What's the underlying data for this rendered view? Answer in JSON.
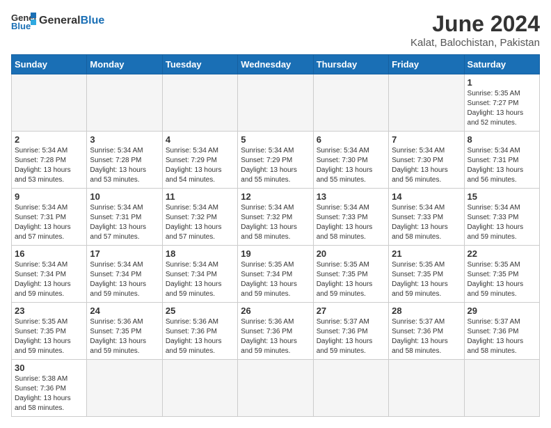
{
  "header": {
    "logo_general": "General",
    "logo_blue": "Blue",
    "month_year": "June 2024",
    "location": "Kalat, Balochistan, Pakistan"
  },
  "columns": [
    "Sunday",
    "Monday",
    "Tuesday",
    "Wednesday",
    "Thursday",
    "Friday",
    "Saturday"
  ],
  "weeks": [
    [
      {
        "day": "",
        "info": ""
      },
      {
        "day": "",
        "info": ""
      },
      {
        "day": "",
        "info": ""
      },
      {
        "day": "",
        "info": ""
      },
      {
        "day": "",
        "info": ""
      },
      {
        "day": "",
        "info": ""
      },
      {
        "day": "1",
        "info": "Sunrise: 5:35 AM\nSunset: 7:27 PM\nDaylight: 13 hours\nand 52 minutes."
      }
    ],
    [
      {
        "day": "2",
        "info": "Sunrise: 5:34 AM\nSunset: 7:28 PM\nDaylight: 13 hours\nand 53 minutes."
      },
      {
        "day": "3",
        "info": "Sunrise: 5:34 AM\nSunset: 7:28 PM\nDaylight: 13 hours\nand 53 minutes."
      },
      {
        "day": "4",
        "info": "Sunrise: 5:34 AM\nSunset: 7:29 PM\nDaylight: 13 hours\nand 54 minutes."
      },
      {
        "day": "5",
        "info": "Sunrise: 5:34 AM\nSunset: 7:29 PM\nDaylight: 13 hours\nand 55 minutes."
      },
      {
        "day": "6",
        "info": "Sunrise: 5:34 AM\nSunset: 7:30 PM\nDaylight: 13 hours\nand 55 minutes."
      },
      {
        "day": "7",
        "info": "Sunrise: 5:34 AM\nSunset: 7:30 PM\nDaylight: 13 hours\nand 56 minutes."
      },
      {
        "day": "8",
        "info": "Sunrise: 5:34 AM\nSunset: 7:31 PM\nDaylight: 13 hours\nand 56 minutes."
      }
    ],
    [
      {
        "day": "9",
        "info": "Sunrise: 5:34 AM\nSunset: 7:31 PM\nDaylight: 13 hours\nand 57 minutes."
      },
      {
        "day": "10",
        "info": "Sunrise: 5:34 AM\nSunset: 7:31 PM\nDaylight: 13 hours\nand 57 minutes."
      },
      {
        "day": "11",
        "info": "Sunrise: 5:34 AM\nSunset: 7:32 PM\nDaylight: 13 hours\nand 57 minutes."
      },
      {
        "day": "12",
        "info": "Sunrise: 5:34 AM\nSunset: 7:32 PM\nDaylight: 13 hours\nand 58 minutes."
      },
      {
        "day": "13",
        "info": "Sunrise: 5:34 AM\nSunset: 7:33 PM\nDaylight: 13 hours\nand 58 minutes."
      },
      {
        "day": "14",
        "info": "Sunrise: 5:34 AM\nSunset: 7:33 PM\nDaylight: 13 hours\nand 58 minutes."
      },
      {
        "day": "15",
        "info": "Sunrise: 5:34 AM\nSunset: 7:33 PM\nDaylight: 13 hours\nand 59 minutes."
      }
    ],
    [
      {
        "day": "16",
        "info": "Sunrise: 5:34 AM\nSunset: 7:34 PM\nDaylight: 13 hours\nand 59 minutes."
      },
      {
        "day": "17",
        "info": "Sunrise: 5:34 AM\nSunset: 7:34 PM\nDaylight: 13 hours\nand 59 minutes."
      },
      {
        "day": "18",
        "info": "Sunrise: 5:34 AM\nSunset: 7:34 PM\nDaylight: 13 hours\nand 59 minutes."
      },
      {
        "day": "19",
        "info": "Sunrise: 5:35 AM\nSunset: 7:34 PM\nDaylight: 13 hours\nand 59 minutes."
      },
      {
        "day": "20",
        "info": "Sunrise: 5:35 AM\nSunset: 7:35 PM\nDaylight: 13 hours\nand 59 minutes."
      },
      {
        "day": "21",
        "info": "Sunrise: 5:35 AM\nSunset: 7:35 PM\nDaylight: 13 hours\nand 59 minutes."
      },
      {
        "day": "22",
        "info": "Sunrise: 5:35 AM\nSunset: 7:35 PM\nDaylight: 13 hours\nand 59 minutes."
      }
    ],
    [
      {
        "day": "23",
        "info": "Sunrise: 5:35 AM\nSunset: 7:35 PM\nDaylight: 13 hours\nand 59 minutes."
      },
      {
        "day": "24",
        "info": "Sunrise: 5:36 AM\nSunset: 7:35 PM\nDaylight: 13 hours\nand 59 minutes."
      },
      {
        "day": "25",
        "info": "Sunrise: 5:36 AM\nSunset: 7:36 PM\nDaylight: 13 hours\nand 59 minutes."
      },
      {
        "day": "26",
        "info": "Sunrise: 5:36 AM\nSunset: 7:36 PM\nDaylight: 13 hours\nand 59 minutes."
      },
      {
        "day": "27",
        "info": "Sunrise: 5:37 AM\nSunset: 7:36 PM\nDaylight: 13 hours\nand 59 minutes."
      },
      {
        "day": "28",
        "info": "Sunrise: 5:37 AM\nSunset: 7:36 PM\nDaylight: 13 hours\nand 58 minutes."
      },
      {
        "day": "29",
        "info": "Sunrise: 5:37 AM\nSunset: 7:36 PM\nDaylight: 13 hours\nand 58 minutes."
      }
    ],
    [
      {
        "day": "30",
        "info": "Sunrise: 5:38 AM\nSunset: 7:36 PM\nDaylight: 13 hours\nand 58 minutes."
      },
      {
        "day": "",
        "info": ""
      },
      {
        "day": "",
        "info": ""
      },
      {
        "day": "",
        "info": ""
      },
      {
        "day": "",
        "info": ""
      },
      {
        "day": "",
        "info": ""
      },
      {
        "day": "",
        "info": ""
      }
    ]
  ]
}
